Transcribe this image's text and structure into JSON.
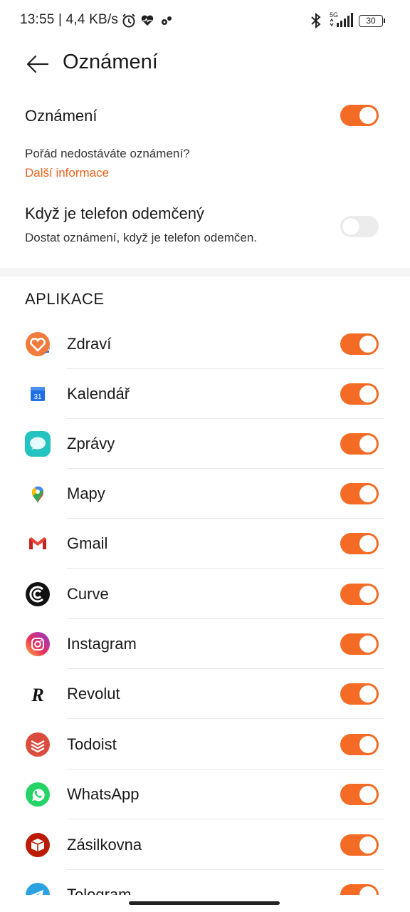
{
  "status_bar": {
    "time_speed": "13:55 | 4,4 KB/s",
    "network": "5G",
    "battery": "30"
  },
  "header": {
    "title": "Oznámení"
  },
  "notifications": {
    "label": "Oznámení",
    "enabled": true,
    "help_text": "Pořád nedostáváte oznámení?",
    "help_link": "Další informace"
  },
  "unlocked": {
    "label": "Když je telefon odemčený",
    "subtitle": "Dostat oznámení, když je telefon odemčen.",
    "enabled": false
  },
  "apps": {
    "section_title": "APLIKACE",
    "items": [
      {
        "name": "Zdraví",
        "icon": "health-icon",
        "enabled": true
      },
      {
        "name": "Kalendář",
        "icon": "calendar-icon",
        "enabled": true
      },
      {
        "name": "Zprávy",
        "icon": "messages-icon",
        "enabled": true
      },
      {
        "name": "Mapy",
        "icon": "maps-icon",
        "enabled": true
      },
      {
        "name": "Gmail",
        "icon": "gmail-icon",
        "enabled": true
      },
      {
        "name": "Curve",
        "icon": "curve-icon",
        "enabled": true
      },
      {
        "name": "Instagram",
        "icon": "instagram-icon",
        "enabled": true
      },
      {
        "name": "Revolut",
        "icon": "revolut-icon",
        "enabled": true
      },
      {
        "name": "Todoist",
        "icon": "todoist-icon",
        "enabled": true
      },
      {
        "name": "WhatsApp",
        "icon": "whatsapp-icon",
        "enabled": true
      },
      {
        "name": "Zásilkovna",
        "icon": "zasilkovna-icon",
        "enabled": true
      },
      {
        "name": "Telegram",
        "icon": "telegram-icon",
        "enabled": true
      }
    ]
  },
  "colors": {
    "accent": "#f46b25",
    "link": "#e8641c",
    "toggle_off": "#ececec"
  }
}
